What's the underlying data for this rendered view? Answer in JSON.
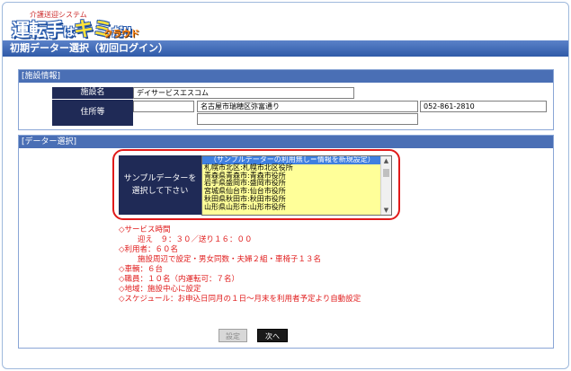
{
  "header": {
    "logo_sub": "介護送迎システム",
    "logo_part1": "運転手",
    "logo_part2": "は",
    "logo_part3": "キミ",
    "logo_part4": "だ!!",
    "logo_part5": "クラウド",
    "title": "初期データー選択（初回ログイン）"
  },
  "facility": {
    "section_label": "[施設情報]",
    "name_label": "施設名",
    "name_value": "デイサービスエスコム",
    "address_label": "住所等",
    "postal_value": "",
    "address_value": "名古屋市瑞穂区弥富通り",
    "phone_value": "052-861-2810",
    "address2_value": ""
  },
  "data_select": {
    "section_label": "[データー選択]",
    "sample_label_line1": "サンプルデーターを",
    "sample_label_line2": "選択して下さい",
    "options": [
      "（サンプルデーターの利用無し＝情報を新規設定）",
      "札幌市北区:札幌市北区役所",
      "青森県青森市:青森市役所",
      "岩手県盛岡市:盛岡市役所",
      "宮城県仙台市:仙台市役所",
      "秋田県秋田市:秋田市役所",
      "山形県山形市:山形市役所"
    ],
    "selected_index": 0,
    "info": [
      {
        "text": "◇サービス時間",
        "indent": false
      },
      {
        "text": "迎え　９：３０／送り１６：００",
        "indent": true
      },
      {
        "text": "◇利用者：６０名",
        "indent": false
      },
      {
        "text": "施設周辺で設定・男女同数・夫婦２組・車椅子１３名",
        "indent": true
      },
      {
        "text": "◇車輌：６台",
        "indent": false
      },
      {
        "text": "◇職員：１０名（内運転可：７名）",
        "indent": false
      },
      {
        "text": "◇地域：施設中心に設定",
        "indent": false
      },
      {
        "text": "◇スケジュール：お申込日同月の１日〜月末を利用者予定より自動設定",
        "indent": false
      }
    ],
    "set_button": "設定",
    "next_button": "次へ"
  }
}
